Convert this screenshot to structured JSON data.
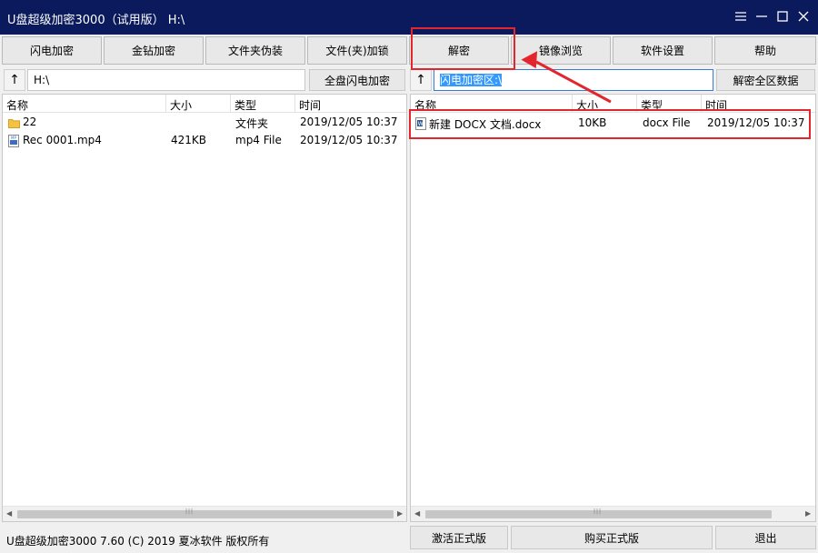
{
  "window": {
    "title": "U盘超级加密3000（试用版） H:\\"
  },
  "toolbar": {
    "buttons": [
      "闪电加密",
      "金钻加密",
      "文件夹伪装",
      "文件(夹)加锁",
      "解密",
      "镜像浏览",
      "软件设置",
      "帮助"
    ]
  },
  "left_panel": {
    "path": "H:\\",
    "action_label": "全盘闪电加密",
    "columns": [
      "名称",
      "大小",
      "类型",
      "时间"
    ],
    "rows": [
      {
        "name": "22",
        "size": "",
        "type": "文件夹",
        "time": "2019/12/05 10:37",
        "icon": "folder-icon"
      },
      {
        "name": "Rec 0001.mp4",
        "size": "421KB",
        "type": "mp4 File",
        "time": "2019/12/05 10:37",
        "icon": "video-file-icon"
      }
    ]
  },
  "right_panel": {
    "path": "闪电加密区:\\",
    "action_label": "解密全区数据",
    "columns": [
      "名称",
      "大小",
      "类型",
      "时间"
    ],
    "rows": [
      {
        "name": "新建 DOCX 文档.docx",
        "size": "10KB",
        "type": "docx File",
        "time": "2019/12/05 10:37",
        "icon": "word-doc-icon"
      }
    ]
  },
  "status": {
    "text": "U盘超级加密3000 7.60 (C) 2019 夏冰软件 版权所有",
    "buttons": [
      "激活正式版",
      "购买正式版",
      "退出"
    ]
  },
  "annotation": {
    "color": "#e3262e"
  }
}
